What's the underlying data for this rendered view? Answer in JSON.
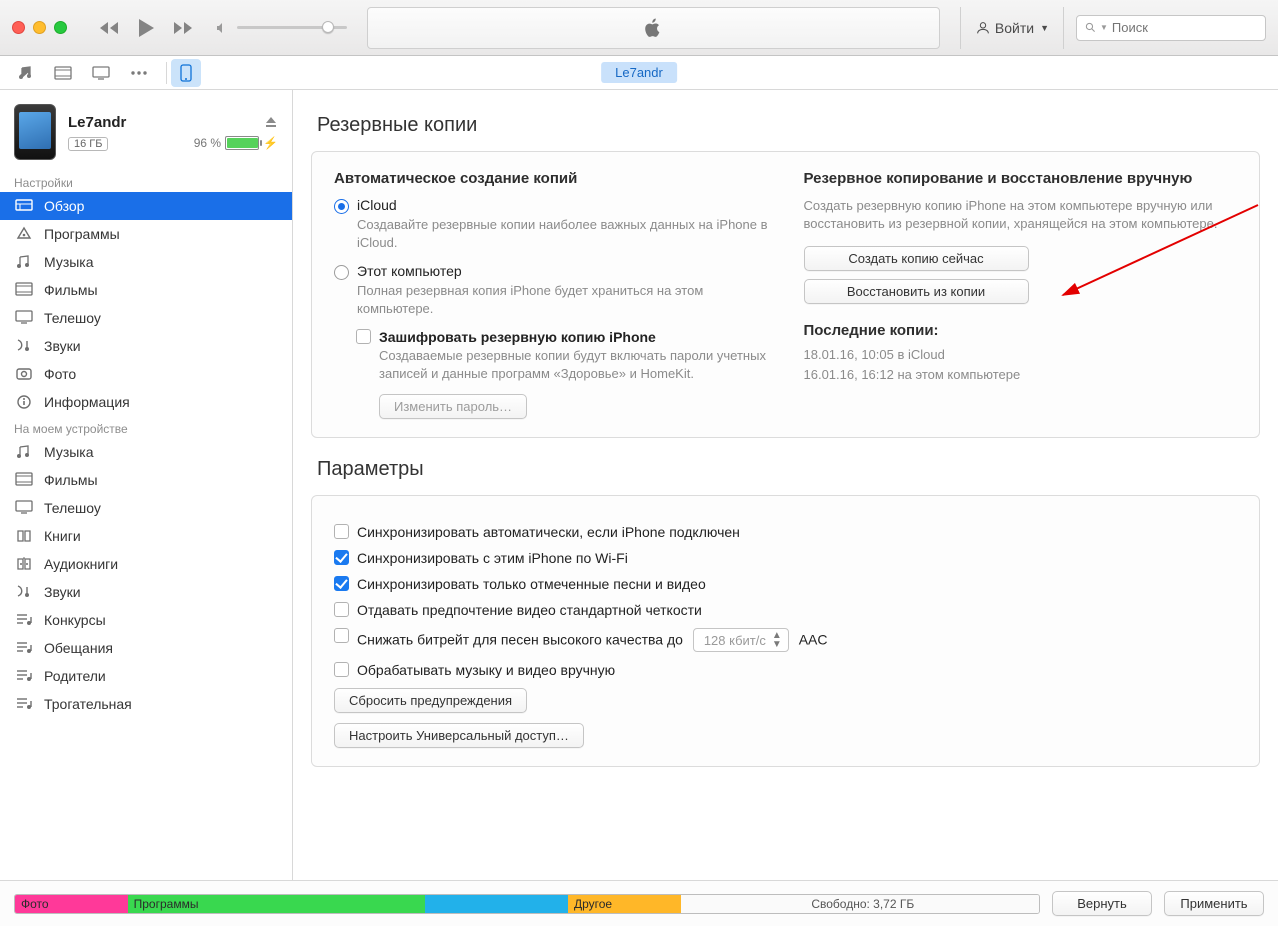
{
  "toolbar": {
    "account_label": "Войти",
    "search_placeholder": "Поиск"
  },
  "device": {
    "name": "Le7andr",
    "capacity": "16 ГБ",
    "battery_pct": "96 %"
  },
  "sidebar": {
    "section1": "Настройки",
    "section2": "На моем устройстве",
    "settings": [
      {
        "label": "Обзор",
        "icon": "overview"
      },
      {
        "label": "Программы",
        "icon": "apps"
      },
      {
        "label": "Музыка",
        "icon": "music"
      },
      {
        "label": "Фильмы",
        "icon": "movies"
      },
      {
        "label": "Телешоу",
        "icon": "tv"
      },
      {
        "label": "Звуки",
        "icon": "tones"
      },
      {
        "label": "Фото",
        "icon": "photos"
      },
      {
        "label": "Информация",
        "icon": "info"
      }
    ],
    "ondevice": [
      {
        "label": "Музыка",
        "icon": "music"
      },
      {
        "label": "Фильмы",
        "icon": "movies"
      },
      {
        "label": "Телешоу",
        "icon": "tv"
      },
      {
        "label": "Книги",
        "icon": "books"
      },
      {
        "label": "Аудиокниги",
        "icon": "audiobooks"
      },
      {
        "label": "Звуки",
        "icon": "tones"
      },
      {
        "label": "Конкурсы",
        "icon": "playlist"
      },
      {
        "label": "Обещания",
        "icon": "playlist"
      },
      {
        "label": "Родители",
        "icon": "playlist"
      },
      {
        "label": "Трогательная",
        "icon": "playlist"
      }
    ]
  },
  "backups": {
    "heading": "Резервные копии",
    "auto_heading": "Автоматическое создание копий",
    "icloud_label": "iCloud",
    "icloud_desc": "Создавайте резервные копии наиболее важных данных на iPhone в iCloud.",
    "thispc_label": "Этот компьютер",
    "thispc_desc": "Полная резервная копия iPhone будет храниться на этом компьютере.",
    "encrypt_label": "Зашифровать резервную копию iPhone",
    "encrypt_desc": "Создаваемые резервные копии будут включать пароли учетных записей и данные программ «Здоровье» и HomeKit.",
    "change_pwd_btn": "Изменить пароль…",
    "manual_heading": "Резервное копирование и восстановление вручную",
    "manual_desc": "Создать резервную копию iPhone на этом компьютере вручную или восстановить из резервной копии, хранящейся на этом компьютере.",
    "backup_now_btn": "Создать копию сейчас",
    "restore_btn": "Восстановить из копии",
    "last_heading": "Последние копии:",
    "last_line1": "18.01.16, 10:05 в iCloud",
    "last_line2": "16.01.16, 16:12 на этом компьютере"
  },
  "params": {
    "heading": "Параметры",
    "opt_autosync": "Синхронизировать автоматически, если iPhone подключен",
    "opt_wifi": "Синхронизировать с этим iPhone по Wi-Fi",
    "opt_checked_only": "Синхронизировать только отмеченные песни и видео",
    "opt_sd": "Отдавать предпочтение видео стандартной четкости",
    "opt_bitrate_pre": "Снижать битрейт для песен высокого качества до",
    "opt_bitrate_select": "128 кбит/с",
    "opt_bitrate_codec": "AAC",
    "opt_manual": "Обрабатывать музыку и видео вручную",
    "reset_warn_btn": "Сбросить предупреждения",
    "accessibility_btn": "Настроить Универсальный доступ…"
  },
  "footer": {
    "segments": [
      {
        "label": "Фото",
        "color": "#ff3999",
        "width": "11%"
      },
      {
        "label": "Программы",
        "color": "#39d84f",
        "width": "29%"
      },
      {
        "label": "",
        "color": "#22b1ea",
        "width": "14%"
      },
      {
        "label": "Другое",
        "color": "#ffb728",
        "width": "11%"
      }
    ],
    "free_label": "Свободно: 3,72 ГБ",
    "revert_btn": "Вернуть",
    "apply_btn": "Применить"
  }
}
